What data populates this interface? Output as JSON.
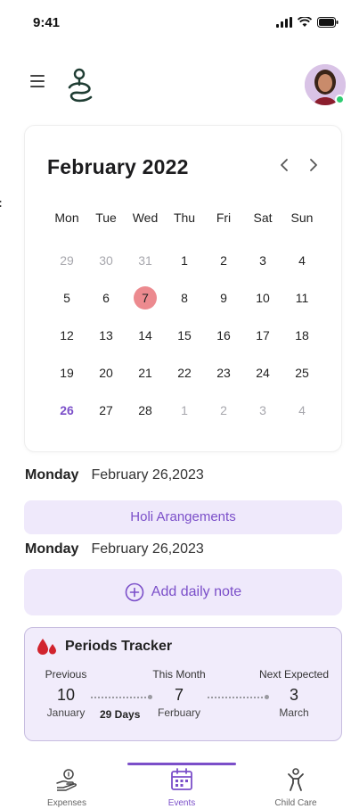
{
  "status_bar": {
    "time": "9:41"
  },
  "side_glyph": ":",
  "calendar": {
    "month_title": "February 2022",
    "weekdays": [
      "Mon",
      "Tue",
      "Wed",
      "Thu",
      "Fri",
      "Sat",
      "Sun"
    ],
    "weeks": [
      [
        "29",
        "30",
        "31",
        "1",
        "2",
        "3",
        "4"
      ],
      [
        "5",
        "6",
        "7",
        "8",
        "9",
        "10",
        "11"
      ],
      [
        "12",
        "13",
        "14",
        "15",
        "16",
        "17",
        "18"
      ],
      [
        "19",
        "20",
        "21",
        "22",
        "23",
        "24",
        "25"
      ],
      [
        "26",
        "27",
        "28",
        "1",
        "2",
        "3",
        "4"
      ]
    ],
    "selected_day": "7",
    "highlight_day": "26"
  },
  "entries": [
    {
      "day": "Monday",
      "date": "February 26,2023",
      "event": "Holi Arangements"
    },
    {
      "day": "Monday",
      "date": "February 26,2023"
    }
  ],
  "add_note": {
    "label": "Add daily note"
  },
  "tracker": {
    "title": "Periods Tracker",
    "previous": {
      "label": "Previous",
      "day": "10",
      "month": "January"
    },
    "gap": "29 Days",
    "this_month": {
      "label": "This Month",
      "day": "7",
      "month": "Ferbuary"
    },
    "next": {
      "label": "Next Expected",
      "day": "3",
      "month": "March"
    }
  },
  "bottom_nav": [
    {
      "label": "Expenses",
      "icon": "wallet-hand-icon"
    },
    {
      "label": "Events",
      "icon": "calendar-icon",
      "active": true
    },
    {
      "label": "Child Care",
      "icon": "child-icon"
    }
  ],
  "colors": {
    "accent": "#7b4fc9",
    "accent_light": "#efe9fb",
    "selected_day": "#ec8a8f",
    "online": "#2ecc71"
  }
}
